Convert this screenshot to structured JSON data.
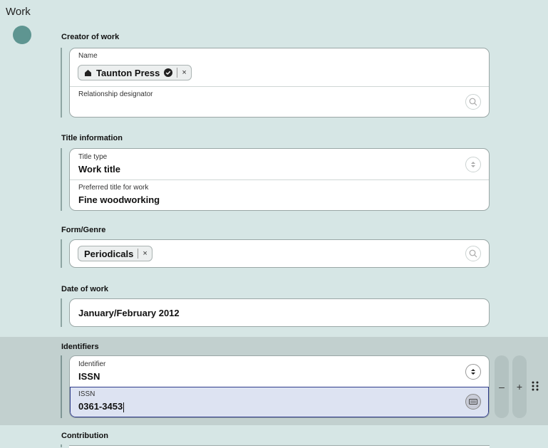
{
  "page": {
    "title": "Work"
  },
  "creator": {
    "section_label": "Creator of work",
    "name_label": "Name",
    "name_chip": "Taunton Press",
    "relationship_label": "Relationship designator"
  },
  "title_info": {
    "section_label": "Title information",
    "type_label": "Title type",
    "type_value": "Work title",
    "preferred_label": "Preferred title for work",
    "preferred_value": "Fine woodworking"
  },
  "form_genre": {
    "section_label": "Form/Genre",
    "chip": "Periodicals"
  },
  "date_of_work": {
    "section_label": "Date of work",
    "value": "January/February 2012"
  },
  "identifiers": {
    "section_label": "Identifiers",
    "identifier_label": "Identifier",
    "identifier_value": "ISSN",
    "issn_label": "ISSN",
    "issn_value": "0361-3453",
    "minus_label": "–",
    "plus_label": "+"
  },
  "contribution": {
    "section_label": "Contribution"
  }
}
